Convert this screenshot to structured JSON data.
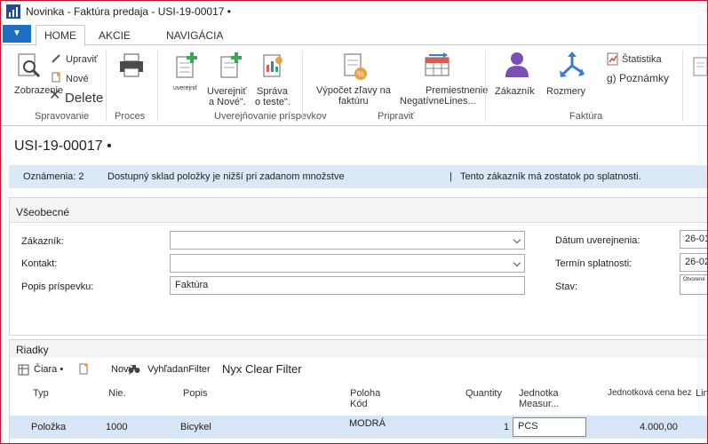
{
  "window": {
    "title": "Novinka - Faktúra predaja - USI-19-00017 •"
  },
  "ribbon": {
    "tabs": {
      "home": "HOME",
      "actions": "AKCIE",
      "navigate": "NAVIGÁCIA"
    },
    "manage": {
      "view": "Zobrazenie",
      "edit": "Upraviť",
      "new": "Nové",
      "delete": "Delete",
      "group": "Spravovanie"
    },
    "process": {
      "group": "Proces"
    },
    "posting": {
      "post": "uverejniť",
      "post_new_1": "Uverejniť",
      "post_new_2": "a Nové\".",
      "test_1": "Správa",
      "test_2": "o teste\".",
      "group": "Uverejňovanie príspevkov"
    },
    "prepare": {
      "calc_1": "Výpočet zľavy na",
      "calc_2": "faktúru",
      "move_1": "Premiestnenie",
      "move_2": "NegatívneLines...",
      "group": "Pripraviť"
    },
    "invoice": {
      "customer": "Zákazník",
      "dimensions": "Rozmery",
      "statistics": "Štatistika",
      "notes": "g) Poznámky",
      "group": "Faktúra"
    }
  },
  "page": {
    "title": "USI-19-00017 •"
  },
  "notifications": {
    "count": "Oznámenia: 2",
    "msg1": "Dostupný sklad položky je nižší pri zadanom množstve",
    "divider": "|",
    "msg2": "Tento zákazník má zostatok po splatnosti."
  },
  "general": {
    "header": "Všeobecné",
    "customer_label": "Zákazník:",
    "customer_value": "",
    "contact_label": "Kontakt:",
    "contact_value": "",
    "desc_label": "Popis príspevku:",
    "desc_value": "Faktúra",
    "posting_date_label": "Dátum uverejnenia:",
    "posting_date_value": "26-01",
    "due_date_label": "Termín splatnosti:",
    "due_date_value": "26-02",
    "status_label": "Stav:",
    "status_value": "Otvorené"
  },
  "lines": {
    "header": "Riadky",
    "toolbar": {
      "line": "Čiara •",
      "new": "Nový",
      "find": "VyhľadanFilter",
      "clear": "Nyx Clear Filter"
    },
    "columns": {
      "type": "Typ",
      "no": "Nie.",
      "desc": "Popis",
      "loc_1": "Poloha",
      "loc_2": "Kód",
      "qty": "Quantity",
      "uom_1": "Jednotka",
      "uom_2": "Measur...",
      "price": "Jednotková cena bez",
      "extra": "Lin"
    },
    "rows": [
      {
        "type": "Položka",
        "no": "1000",
        "desc": "Bicykel",
        "loc": "MODRÁ",
        "qty": "1",
        "uom": "PCS",
        "price": "4.000,00"
      }
    ]
  },
  "colors": {
    "accent": "#1e6fc4",
    "notification": "#dbe9f6",
    "selected_row": "#d6e6f6",
    "frame_border": "#c8102e"
  }
}
